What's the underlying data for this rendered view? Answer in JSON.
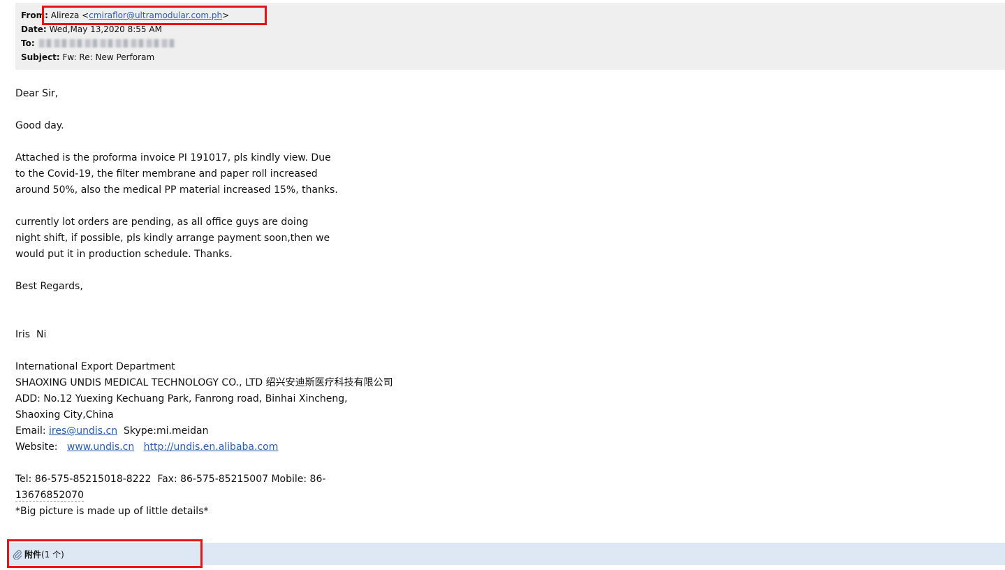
{
  "header": {
    "from_label": "From:",
    "from_name": "Alireza",
    "from_email": "cmiraflor@ultramodular.com.ph",
    "date_label": "Date:",
    "date_value": "Wed,May 13,2020 8:55 AM",
    "to_label": "To:",
    "subject_label": "Subject:",
    "subject_value": "Fw: Re: New Perforam"
  },
  "body": {
    "greeting": "Dear Sir,",
    "good_day": "Good day.",
    "paragraph1": [
      "Attached is the proforma invoice PI 191017, pls kindly view. Due",
      "to the Covid-19, the filter membrane and paper roll increased",
      "around 50%, also the medical PP material increased 15%, thanks."
    ],
    "paragraph2": [
      "currently lot orders are pending, as all office guys are doing",
      "night shift, if possible, pls kindly arrange payment soon,then we",
      "would put it in production schedule. Thanks."
    ],
    "closing": "Best Regards,"
  },
  "signature": {
    "name": "Iris  Ni",
    "department": "International Export Department",
    "company": "SHAOXING UNDIS MEDICAL TECHNOLOGY CO., LTD 绍兴安迪斯医疗科技有限公司",
    "address_line1": "ADD: No.12 Yuexing Kechuang Park, Fanrong road, Binhai Xincheng,",
    "address_line2": "Shaoxing City,China",
    "email_label": "Email: ",
    "email_link": "ires@undis.cn",
    "skype": "  Skype:mi.meidan",
    "website_label": "Website:   ",
    "website_link1": "www.undis.cn",
    "website_sep": "   ",
    "website_link2": "http://undis.en.alibaba.com",
    "phone_line1": "Tel: 86-575-85215018-8222  Fax: 86-575-85215007 Mobile: 86-",
    "phone_line2": "13676852070",
    "motto": "*Big picture is made up of little details*"
  },
  "attachments": {
    "icon": "paperclip-icon",
    "title": "附件",
    "count": "(1 个)"
  },
  "colors": {
    "header_bg": "#efefef",
    "link": "#2a5db0",
    "highlight_box": "#ee1111",
    "attachment_bar": "#dde8f4"
  }
}
